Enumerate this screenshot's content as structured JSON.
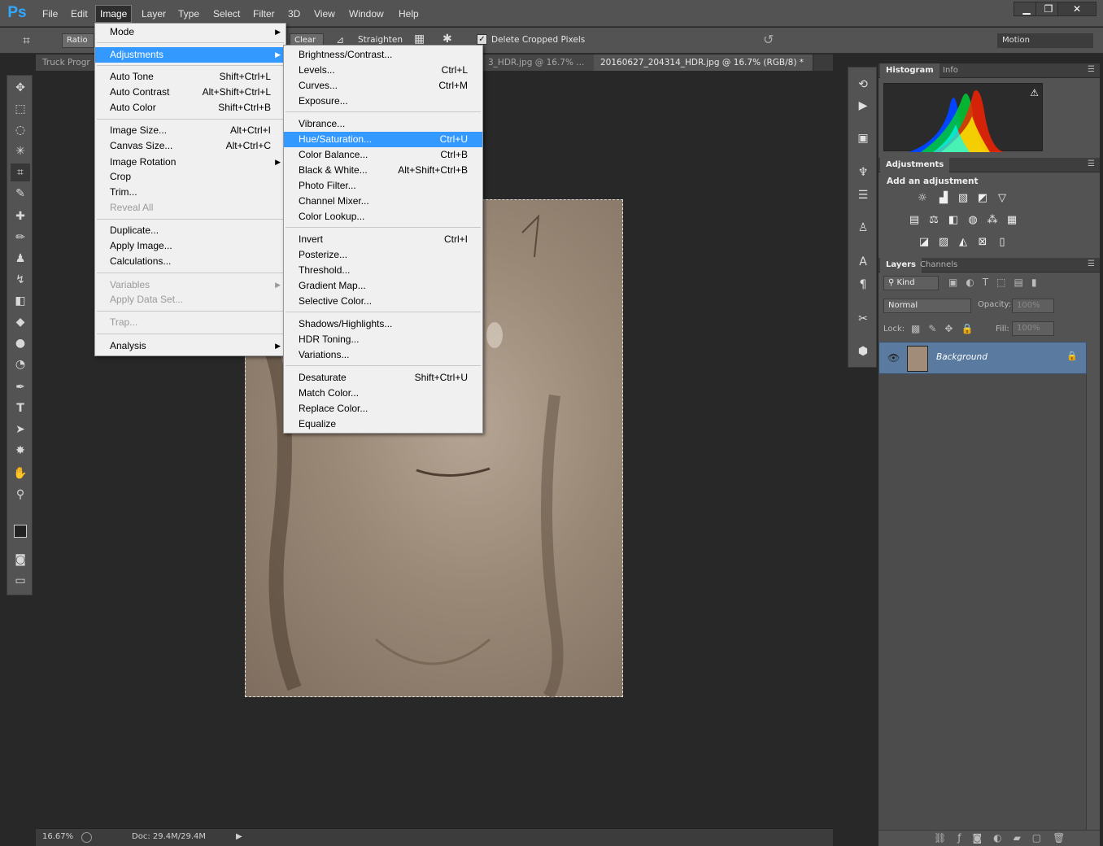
{
  "app": {
    "logo": "Ps"
  },
  "menubar": {
    "items": [
      "File",
      "Edit",
      "Image",
      "Layer",
      "Type",
      "Select",
      "Filter",
      "3D",
      "View",
      "Window",
      "Help"
    ],
    "minimize": "▁",
    "restore": "❐",
    "close": "✕"
  },
  "options": {
    "ratio": "Ratio",
    "clear": "Clear",
    "straighten": "Straighten",
    "delete_cropped": "Delete Cropped Pixels",
    "workspace": "Motion"
  },
  "tabs": [
    {
      "label": "Truck Progr"
    },
    {
      "label": "3_HDR.jpg @ 16.7% ..."
    },
    {
      "label": "20160627_204314_HDR.jpg @ 16.7% (RGB/8) *"
    }
  ],
  "status": {
    "zoom": "16.67%",
    "doc": "Doc: 29.4M/29.4M"
  },
  "panels": {
    "histogram": {
      "tabs": [
        "Histogram",
        "Info"
      ]
    },
    "adjustments": {
      "tab": "Adjustments",
      "title": "Add an adjustment"
    },
    "layers": {
      "tabs": [
        "Layers",
        "Channels"
      ],
      "kind": "Kind",
      "blend": "Normal",
      "opacity_label": "Opacity:",
      "opacity": "100%",
      "lock_label": "Lock:",
      "fill_label": "Fill:",
      "fill": "100%",
      "layer_name": "Background"
    }
  },
  "image_menu": {
    "items": [
      {
        "label": "Mode",
        "arrow": true
      },
      {
        "label": "Adjustments",
        "arrow": true,
        "highlight": true
      },
      {
        "label": "Auto Tone",
        "shortcut": "Shift+Ctrl+L"
      },
      {
        "label": "Auto Contrast",
        "shortcut": "Alt+Shift+Ctrl+L"
      },
      {
        "label": "Auto Color",
        "shortcut": "Shift+Ctrl+B"
      },
      {
        "label": "Image Size...",
        "shortcut": "Alt+Ctrl+I"
      },
      {
        "label": "Canvas Size...",
        "shortcut": "Alt+Ctrl+C"
      },
      {
        "label": "Image Rotation",
        "arrow": true
      },
      {
        "label": "Crop"
      },
      {
        "label": "Trim..."
      },
      {
        "label": "Reveal All",
        "disabled": true
      },
      {
        "label": "Duplicate..."
      },
      {
        "label": "Apply Image..."
      },
      {
        "label": "Calculations..."
      },
      {
        "label": "Variables",
        "arrow": true,
        "disabled": true
      },
      {
        "label": "Apply Data Set...",
        "disabled": true
      },
      {
        "label": "Trap...",
        "disabled": true
      },
      {
        "label": "Analysis",
        "arrow": true
      }
    ]
  },
  "adjustments_menu": {
    "items": [
      {
        "label": "Brightness/Contrast..."
      },
      {
        "label": "Levels...",
        "shortcut": "Ctrl+L"
      },
      {
        "label": "Curves...",
        "shortcut": "Ctrl+M"
      },
      {
        "label": "Exposure..."
      },
      {
        "label": "Vibrance..."
      },
      {
        "label": "Hue/Saturation...",
        "shortcut": "Ctrl+U",
        "highlight": true
      },
      {
        "label": "Color Balance...",
        "shortcut": "Ctrl+B"
      },
      {
        "label": "Black & White...",
        "shortcut": "Alt+Shift+Ctrl+B"
      },
      {
        "label": "Photo Filter..."
      },
      {
        "label": "Channel Mixer..."
      },
      {
        "label": "Color Lookup..."
      },
      {
        "label": "Invert",
        "shortcut": "Ctrl+I"
      },
      {
        "label": "Posterize..."
      },
      {
        "label": "Threshold..."
      },
      {
        "label": "Gradient Map..."
      },
      {
        "label": "Selective Color..."
      },
      {
        "label": "Shadows/Highlights..."
      },
      {
        "label": "HDR Toning..."
      },
      {
        "label": "Variations..."
      },
      {
        "label": "Desaturate",
        "shortcut": "Shift+Ctrl+U"
      },
      {
        "label": "Match Color..."
      },
      {
        "label": "Replace Color..."
      },
      {
        "label": "Equalize"
      }
    ]
  }
}
